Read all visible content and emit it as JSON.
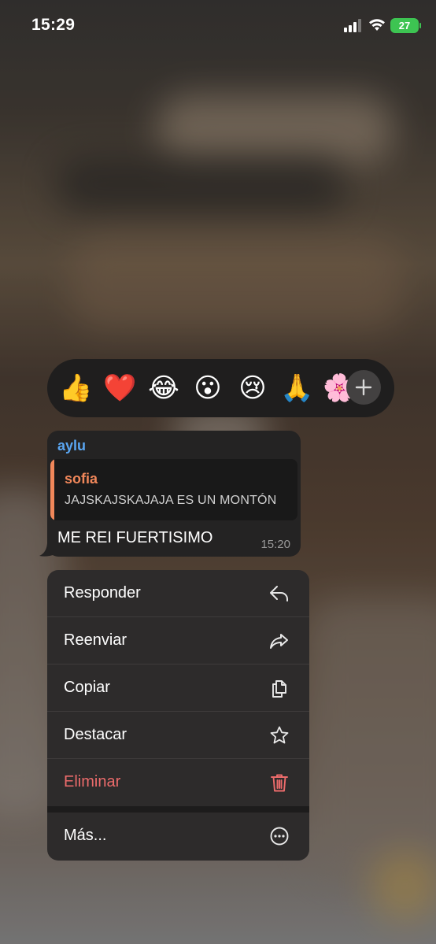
{
  "status_bar": {
    "time": "15:29",
    "battery_level": "27",
    "battery_color": "#3dc452"
  },
  "reactions": {
    "emojis": [
      "👍",
      "❤️",
      "😂",
      "😮",
      "😢",
      "🙏",
      "🌸"
    ],
    "add_icon": "plus-icon"
  },
  "message": {
    "sender": "aylu",
    "sender_color": "#5aa6f2",
    "reply": {
      "name": "sofia",
      "text": "JAJSKAJSKAJAJA ES UN MONTÓN",
      "accent_color": "#f0875a"
    },
    "text": "ME REI FUERTISIMO",
    "time": "15:20"
  },
  "menu": {
    "items": [
      {
        "label": "Responder",
        "icon": "reply-icon"
      },
      {
        "label": "Reenviar",
        "icon": "forward-icon"
      },
      {
        "label": "Copiar",
        "icon": "copy-icon"
      },
      {
        "label": "Destacar",
        "icon": "star-icon"
      },
      {
        "label": "Eliminar",
        "icon": "trash-icon",
        "color": "#eb6b6b"
      },
      {
        "label": "Más...",
        "icon": "more-icon"
      }
    ]
  }
}
